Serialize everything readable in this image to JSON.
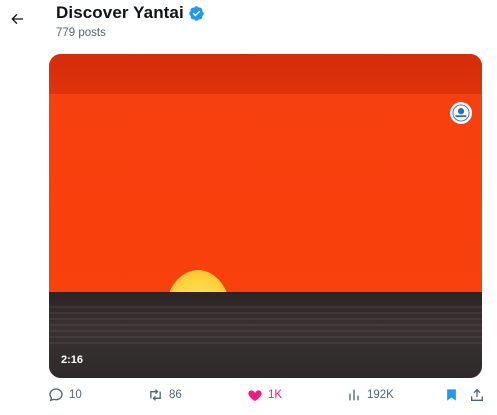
{
  "header": {
    "title": "Discover Yantai",
    "post_count": "779 posts"
  },
  "media": {
    "duration": "2:16"
  },
  "actions": {
    "replies": "10",
    "reposts": "86",
    "likes": "1K",
    "views": "192K"
  },
  "icons": {
    "back": "back-arrow-icon",
    "verified": "verified-badge-icon",
    "reply": "reply-icon",
    "repost": "repost-icon",
    "like": "heart-icon",
    "views": "views-icon",
    "bookmark": "bookmark-icon",
    "share": "share-icon"
  },
  "colors": {
    "verified": "#1d9bf0",
    "like_active": "#f91880",
    "bookmark_active": "#1d9bf0",
    "muted_text": "#536471"
  }
}
